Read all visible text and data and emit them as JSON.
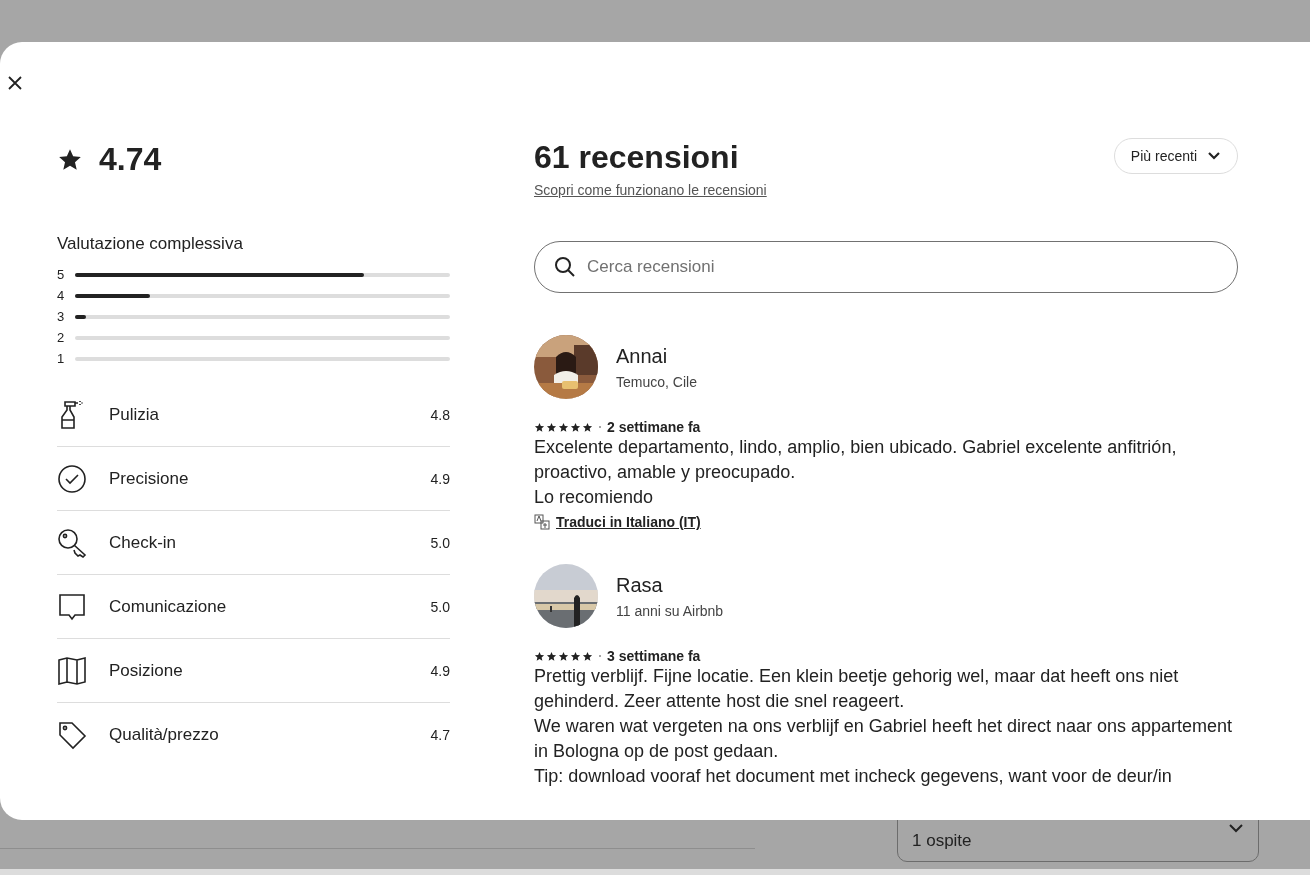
{
  "page": {
    "guests_select": {
      "value": "1 ospite"
    }
  },
  "modal": {
    "overall": {
      "rating": "4.74",
      "heading": "Valutazione complessiva",
      "distribution": [
        {
          "label": "5",
          "level": 0.77
        },
        {
          "label": "4",
          "level": 0.2
        },
        {
          "label": "3",
          "level": 0.03
        },
        {
          "label": "2",
          "level": 0
        },
        {
          "label": "1",
          "level": 0
        }
      ]
    },
    "categories": [
      {
        "kind": "cleaning",
        "label": "Pulizia",
        "score": "4.8"
      },
      {
        "kind": "accuracy",
        "label": "Precisione",
        "score": "4.9"
      },
      {
        "kind": "checkin",
        "label": "Check-in",
        "score": "5.0"
      },
      {
        "kind": "communication",
        "label": "Comunicazione",
        "score": "5.0"
      },
      {
        "kind": "location",
        "label": "Posizione",
        "score": "4.9"
      },
      {
        "kind": "value",
        "label": "Qualità/prezzo",
        "score": "4.7"
      }
    ],
    "reviews_title": "61 recensioni",
    "how_link": "Scopri come funzionano le recensioni",
    "sort": "Più recenti",
    "search": {
      "placeholder": "Cerca recensioni"
    },
    "reviews": [
      {
        "name": "Annai",
        "subtitle": "Temuco, Cile",
        "stars": 5,
        "when": "2 settimane fa",
        "paragraphs": [
          "Excelente departamento, lindo, amplio, bien ubicado. Gabriel excelente anfitrión, proactivo, amable y preocupado.",
          "Lo recomiendo"
        ],
        "translate": "Traduci in Italiano (IT)"
      },
      {
        "name": "Rasa",
        "subtitle": "11 anni su Airbnb",
        "stars": 5,
        "when": "3 settimane fa",
        "paragraphs": [
          "Prettig verblijf. Fijne locatie. Een klein beetje gehorig wel, maar dat heeft ons niet gehinderd. Zeer attente host die snel reageert.",
          "We waren wat vergeten na ons verblijf en Gabriel heeft het direct naar ons appartement in Bologna op de post gedaan.",
          "Tip: download vooraf het document met incheck gegevens, want voor de deur/in"
        ]
      }
    ]
  }
}
